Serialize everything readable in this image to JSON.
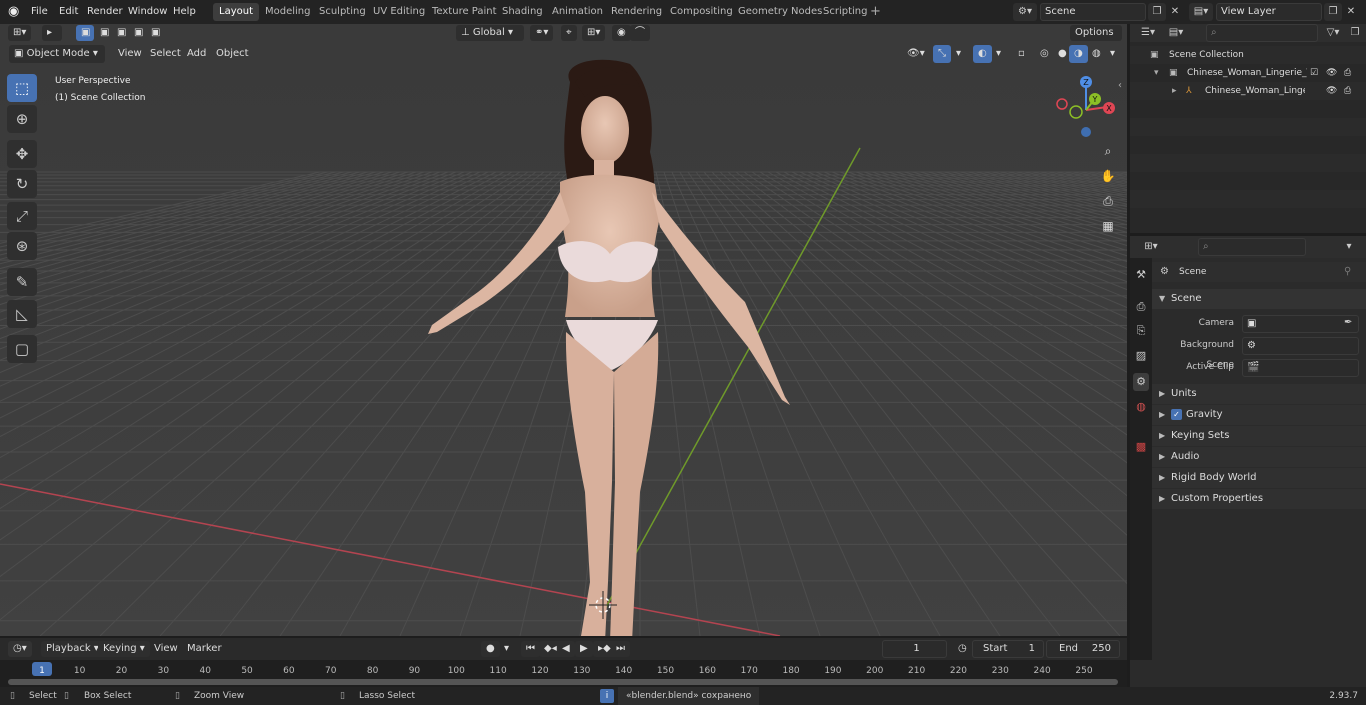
{
  "menu": [
    "File",
    "Edit",
    "Render",
    "Window",
    "Help"
  ],
  "workspaces": [
    "Layout",
    "Modeling",
    "Sculpting",
    "UV Editing",
    "Texture Paint",
    "Shading",
    "Animation",
    "Rendering",
    "Compositing",
    "Geometry Nodes",
    "Scripting"
  ],
  "scene_field": "Scene",
  "viewlayer_field": "View Layer",
  "viewport_header": {
    "mode": "Object Mode",
    "view": "View",
    "select": "Select",
    "add": "Add",
    "object": "Object",
    "orientation": "Global",
    "options": "Options"
  },
  "viewport_overlay": {
    "perspective": "User Perspective",
    "collection": "(1) Scene Collection"
  },
  "gizmo": {
    "x": "X",
    "y": "Y",
    "z": "Z"
  },
  "outliner": {
    "root": "Scene Collection",
    "row1": "Chinese_Woman_Lingerie_T-p",
    "row2": "Chinese_Woman_Lingeri"
  },
  "properties": {
    "context": "Scene",
    "panel_scene": "Scene",
    "camera_label": "Camera",
    "bg_scene_label": "Background Scene",
    "active_clip_label": "Active Clip",
    "panels": [
      "Units",
      "Gravity",
      "Keying Sets",
      "Audio",
      "Rigid Body World",
      "Custom Properties"
    ]
  },
  "timeline": {
    "playback": "Playback",
    "keying": "Keying",
    "view": "View",
    "marker": "Marker",
    "current_frame": "1",
    "start_label": "Start",
    "start_value": "1",
    "end_label": "End",
    "end_value": "250",
    "ticks": [
      "1",
      "10",
      "20",
      "30",
      "40",
      "50",
      "60",
      "70",
      "80",
      "90",
      "100",
      "110",
      "120",
      "130",
      "140",
      "150",
      "160",
      "170",
      "180",
      "190",
      "200",
      "210",
      "220",
      "230",
      "240",
      "250"
    ]
  },
  "statusbar": {
    "select": "Select",
    "box_select": "Box Select",
    "zoom_view": "Zoom View",
    "lasso_select": "Lasso Select",
    "message": "«blender.blend» сохранено",
    "version": "2.93.7"
  },
  "colors": {
    "accent": "#4772b3",
    "x_axis": "#e04654",
    "y_axis": "#8cbf26",
    "z_axis": "#4f8ee6"
  }
}
